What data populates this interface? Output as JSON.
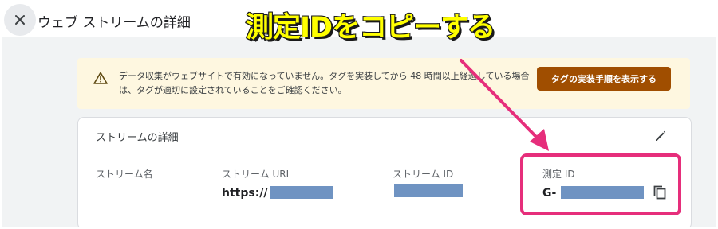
{
  "header": {
    "title": "ウェブ ストリームの詳細",
    "close_icon": "close-icon"
  },
  "banner": {
    "icon": "warning-icon",
    "message": "データ収集がウェブサイトで有効になっていません。タグを実装してから 48 時間以上経過している場合は、タグが適切に設定されていることをご確認ください。",
    "button_label": "タグの実装手順を表示する"
  },
  "stream_details": {
    "section_title": "ストリームの詳細",
    "edit_icon": "edit-icon",
    "fields": [
      {
        "label": "ストリーム名",
        "value": ""
      },
      {
        "label": "ストリーム URL",
        "value": "https://"
      },
      {
        "label": "ストリーム ID",
        "value": ""
      },
      {
        "label": "測定 ID",
        "value": "G-"
      }
    ],
    "copy_icon": "copy-icon"
  },
  "annotation": {
    "callout_text": "測定IDをコピーする",
    "colors": {
      "callout_fill": "#ffff00",
      "callout_stroke": "#1a1a1a",
      "highlight": "#e62e7b"
    }
  },
  "colors": {
    "banner_bg": "#fef7e0",
    "banner_button": "#a04e00",
    "redaction": "#6f93c2"
  }
}
